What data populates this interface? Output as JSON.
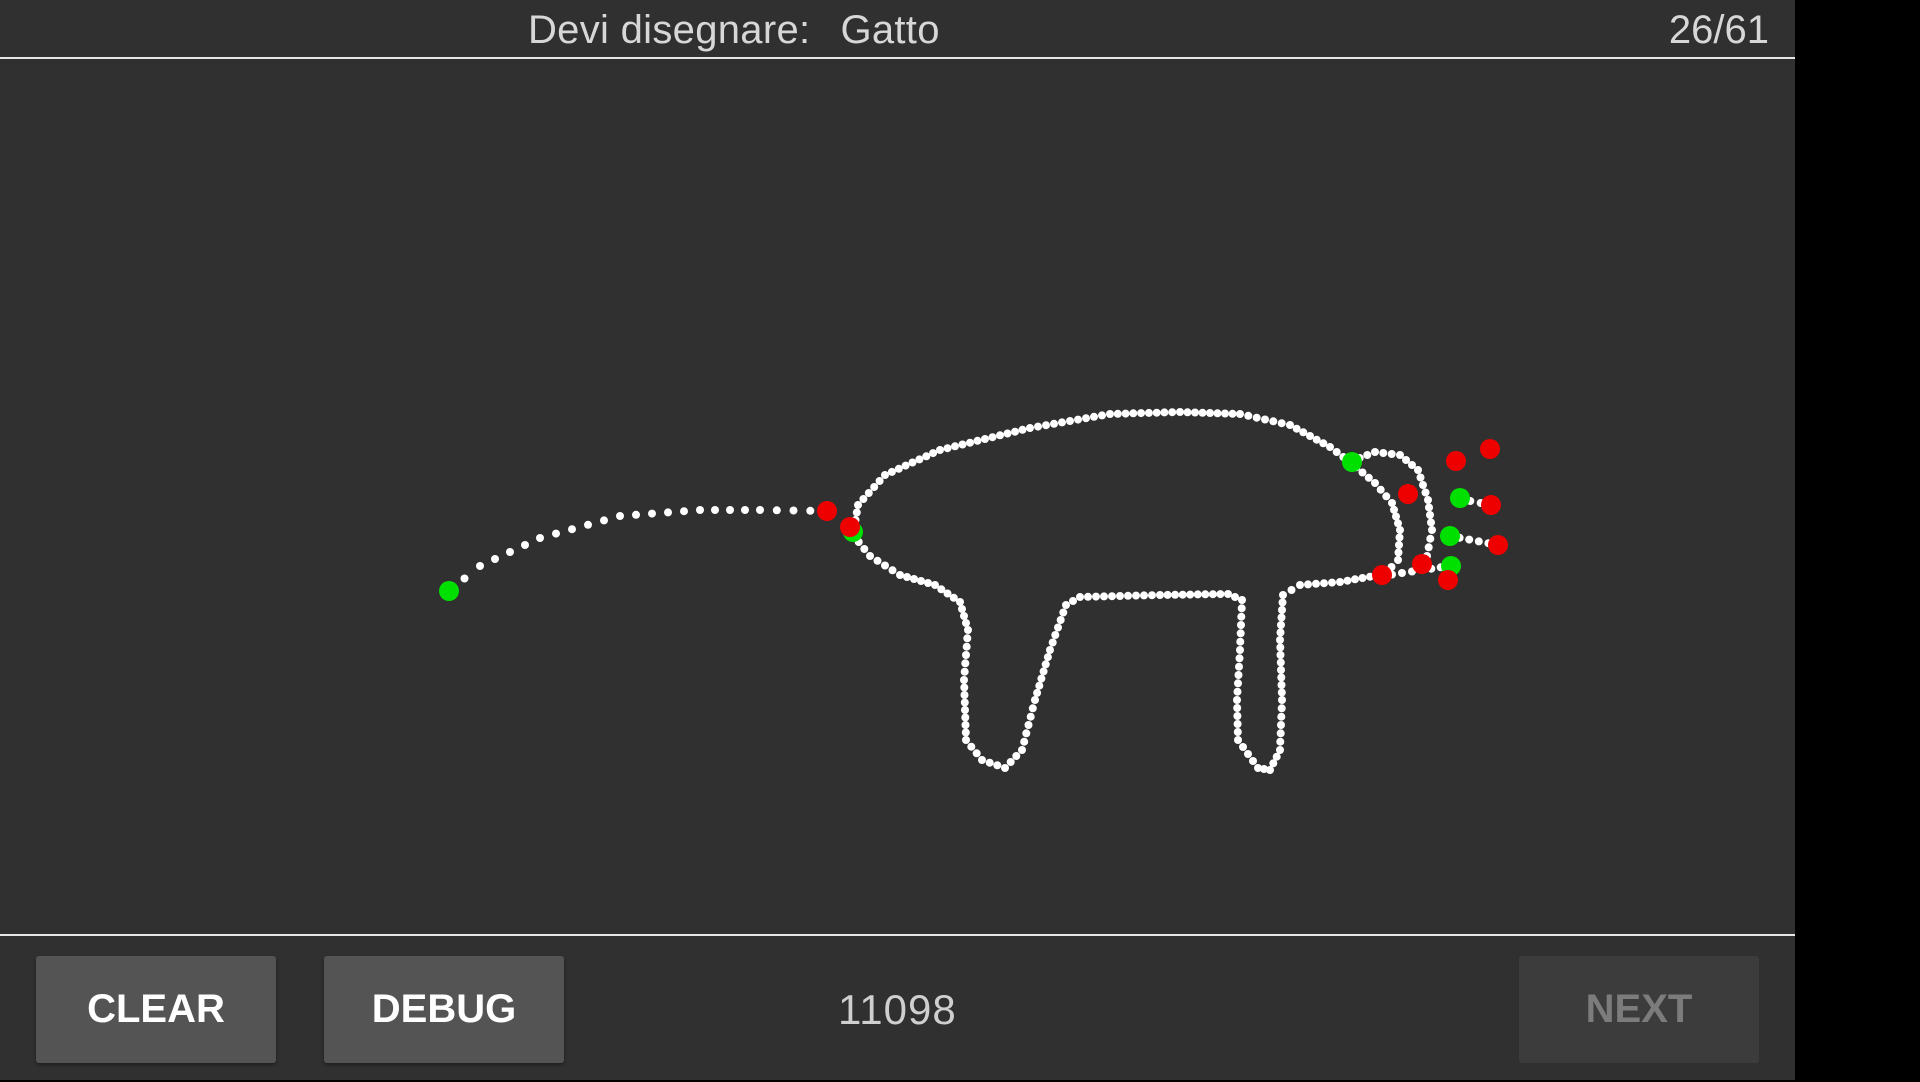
{
  "header": {
    "prompt_label": "Devi disegnare:",
    "target_word": "Gatto",
    "progress": "26/61"
  },
  "footer": {
    "clear_label": "CLEAR",
    "debug_label": "DEBUG",
    "score": "11098",
    "next_label": "NEXT",
    "next_enabled": false
  },
  "colors": {
    "background": "#303030",
    "stroke_dots": "#ffffff",
    "stroke_start": "#00e000",
    "stroke_end": "#ee0000",
    "button": "#545454",
    "button_disabled": "#3c3c3c"
  },
  "drawing": {
    "subject": "cat",
    "stroke_count": 9,
    "endpoint_markers": {
      "start_color": "green",
      "end_color": "red"
    }
  }
}
